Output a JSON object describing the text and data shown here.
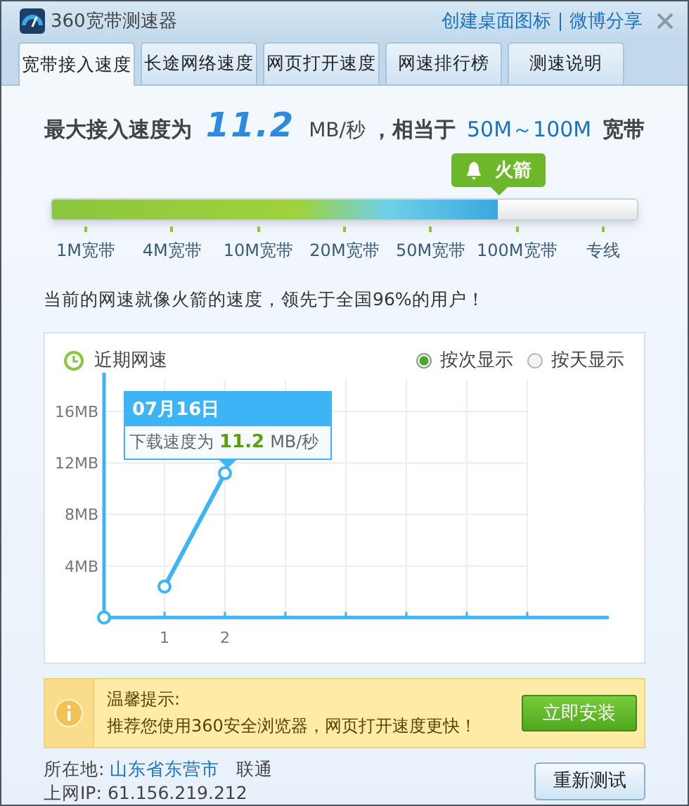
{
  "window": {
    "title": "360宽带测速器",
    "links": [
      "创建桌面图标",
      "微博分享"
    ]
  },
  "tabs": [
    {
      "label": "宽带接入速度",
      "selected": true
    },
    {
      "label": "长途网络速度",
      "selected": false
    },
    {
      "label": "网页打开速度",
      "selected": false
    },
    {
      "label": "网速排行榜",
      "selected": false
    },
    {
      "label": "测速说明",
      "selected": false
    }
  ],
  "headline": {
    "prefix": "最大接入速度为",
    "speed": "11.2",
    "unit": "MB/秒",
    "middle": "，相当于",
    "band": "50M～100M",
    "suffix": "宽带"
  },
  "meter": {
    "level": 0.763,
    "badge": "火箭",
    "ticks": [
      "1M宽带",
      "4M宽带",
      "10M宽带",
      "20M宽带",
      "50M宽带",
      "100M宽带",
      "专线"
    ]
  },
  "summary": "当前的网速就像火箭的速度，领先于全国96%的用户！",
  "recent": {
    "title": "近期网速",
    "modes": [
      {
        "label": "按次显示",
        "selected": true
      },
      {
        "label": "按天显示",
        "selected": false
      }
    ],
    "tooltip": {
      "date": "07月16日",
      "prefix": "下载速度为",
      "value": "11.2",
      "unit": "MB/秒"
    },
    "chart_data": {
      "type": "line",
      "x": [
        1,
        2
      ],
      "series": [
        {
          "color": "#3cb4f5",
          "values": [
            2.4,
            11.2
          ],
          "marker": true
        }
      ],
      "grid": true,
      "xlim": [
        0,
        8.35
      ],
      "ylim": [
        0,
        19
      ],
      "xticks": [
        1,
        2
      ],
      "yticks": [
        {
          "value": 4,
          "label": "4MB"
        },
        {
          "value": 8,
          "label": "8MB"
        },
        {
          "value": 12,
          "label": "12MB"
        },
        {
          "value": 16,
          "label": "16MB"
        }
      ]
    }
  },
  "tip": {
    "title": "温馨提示:",
    "text": "推荐您使用360安全浏览器，网页打开速度更快！",
    "button": "立即安装"
  },
  "location": {
    "label": "所在地:",
    "place": "山东省东营市",
    "isp": "联通",
    "ip_label": "上网IP:",
    "ip": "61.156.219.212"
  },
  "retest_button": "重新测试"
}
